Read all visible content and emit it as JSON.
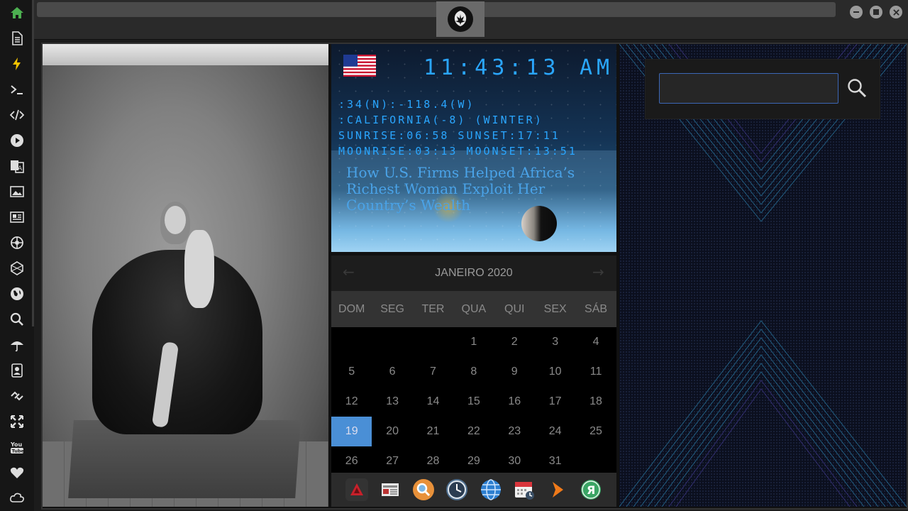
{
  "sidebar": {
    "icons": [
      "home-icon",
      "document-icon",
      "bolt-icon",
      "terminal-icon",
      "code-icon",
      "play-icon",
      "translate-icon",
      "image-icon",
      "news-icon",
      "settings-wheel-icon",
      "hexagon-icon",
      "globe-icon",
      "search-icon",
      "umbrella-icon",
      "contacts-icon",
      "link-icon",
      "expand-icon",
      "youtube-icon",
      "heart-icon",
      "cloud-icon"
    ],
    "accent": "#4caf50"
  },
  "clock": {
    "time": "11:43:13",
    "ampm": "AM",
    "coords": ":34(N):-118.4(W)",
    "location": ":CALIFORNIA(-8) (WINTER)",
    "sun": "SUNRISE:06:58 SUNSET:17:11",
    "moon": "MOONRISE:03:13 MOONSET:13:51",
    "headline": "How U.S. Firms Helped Africa’s Richest Woman Exploit Her Country’s Wealth"
  },
  "calendar": {
    "month_label": "JANEIRO 2020",
    "prev_arrow": "←",
    "next_arrow": "→",
    "weekdays": [
      "DOM",
      "SEG",
      "TER",
      "QUA",
      "QUI",
      "SEX",
      "SÁB"
    ],
    "weeks": [
      [
        "",
        "",
        "",
        "1",
        "2",
        "3",
        "4"
      ],
      [
        "5",
        "6",
        "7",
        "8",
        "9",
        "10",
        "11"
      ],
      [
        "12",
        "13",
        "14",
        "15",
        "16",
        "17",
        "18"
      ],
      [
        "19",
        "20",
        "21",
        "22",
        "23",
        "24",
        "25"
      ],
      [
        "26",
        "27",
        "28",
        "29",
        "30",
        "31",
        ""
      ]
    ],
    "today": "19",
    "today_color": "#4a8fd6"
  },
  "dock": {
    "apps": [
      "app-red-triangle-icon",
      "newspaper-icon",
      "magnifier-app-icon",
      "clock-app-icon",
      "browser-globe-icon",
      "calendar-app-icon",
      "arrow-app-icon",
      "yandex-icon"
    ]
  },
  "search": {
    "value": "",
    "placeholder": ""
  }
}
